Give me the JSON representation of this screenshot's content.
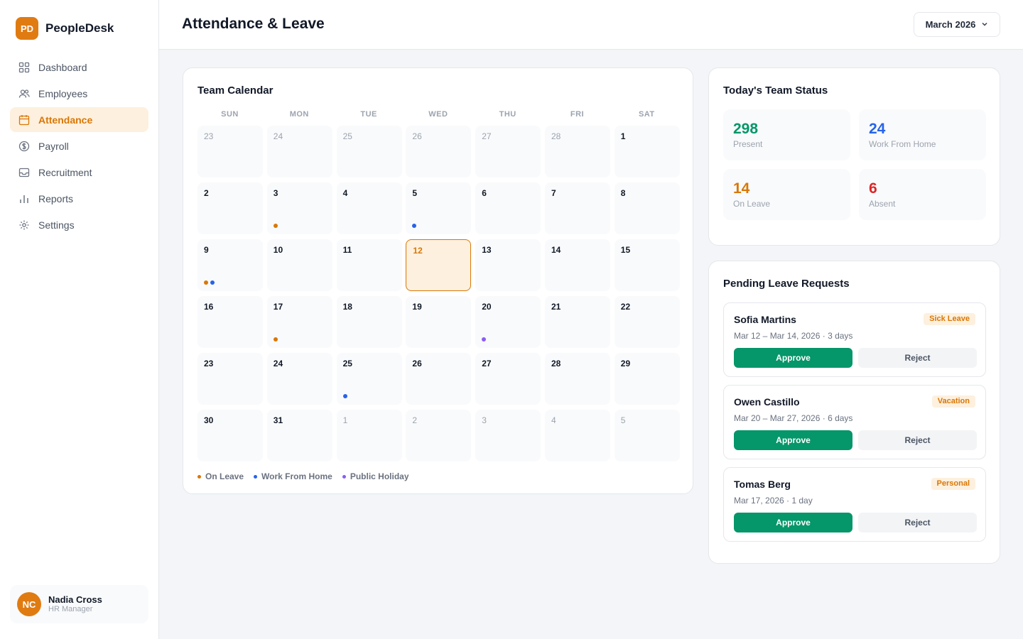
{
  "brand": {
    "logo": "PD",
    "name": "PeopleDesk"
  },
  "nav": [
    {
      "label": "Dashboard",
      "icon": "grid-icon",
      "active": false
    },
    {
      "label": "Employees",
      "icon": "users-icon",
      "active": false
    },
    {
      "label": "Attendance",
      "icon": "calendar-icon",
      "active": true
    },
    {
      "label": "Payroll",
      "icon": "dollar-icon",
      "active": false
    },
    {
      "label": "Recruitment",
      "icon": "inbox-icon",
      "active": false
    },
    {
      "label": "Reports",
      "icon": "bar-chart-icon",
      "active": false
    },
    {
      "label": "Settings",
      "icon": "gear-icon",
      "active": false
    }
  ],
  "user": {
    "initials": "NC",
    "name": "Nadia Cross",
    "role": "HR Manager"
  },
  "header": {
    "title": "Attendance & Leave",
    "month": "March 2026"
  },
  "calendar": {
    "title": "Team Calendar",
    "weekdays": [
      "SUN",
      "MON",
      "TUE",
      "WED",
      "THU",
      "FRI",
      "SAT"
    ],
    "days": [
      {
        "n": "23",
        "muted": true
      },
      {
        "n": "24",
        "muted": true
      },
      {
        "n": "25",
        "muted": true
      },
      {
        "n": "26",
        "muted": true
      },
      {
        "n": "27",
        "muted": true
      },
      {
        "n": "28",
        "muted": true
      },
      {
        "n": "1"
      },
      {
        "n": "2"
      },
      {
        "n": "3",
        "events": [
          "leave"
        ]
      },
      {
        "n": "4"
      },
      {
        "n": "5",
        "events": [
          "wfh"
        ]
      },
      {
        "n": "6"
      },
      {
        "n": "7"
      },
      {
        "n": "8"
      },
      {
        "n": "9",
        "events": [
          "leave",
          "wfh"
        ]
      },
      {
        "n": "10"
      },
      {
        "n": "11"
      },
      {
        "n": "12",
        "today": true
      },
      {
        "n": "13"
      },
      {
        "n": "14"
      },
      {
        "n": "15"
      },
      {
        "n": "16"
      },
      {
        "n": "17",
        "events": [
          "leave"
        ]
      },
      {
        "n": "18"
      },
      {
        "n": "19"
      },
      {
        "n": "20",
        "events": [
          "holiday"
        ]
      },
      {
        "n": "21"
      },
      {
        "n": "22"
      },
      {
        "n": "23"
      },
      {
        "n": "24"
      },
      {
        "n": "25",
        "events": [
          "wfh"
        ]
      },
      {
        "n": "26"
      },
      {
        "n": "27"
      },
      {
        "n": "28"
      },
      {
        "n": "29"
      },
      {
        "n": "30"
      },
      {
        "n": "31"
      },
      {
        "n": "1",
        "muted": true
      },
      {
        "n": "2",
        "muted": true
      },
      {
        "n": "3",
        "muted": true
      },
      {
        "n": "4",
        "muted": true
      },
      {
        "n": "5",
        "muted": true
      }
    ],
    "legend": [
      {
        "key": "leave",
        "label": "On Leave",
        "color": "#d97706"
      },
      {
        "key": "wfh",
        "label": "Work From Home",
        "color": "#2563eb"
      },
      {
        "key": "holiday",
        "label": "Public Holiday",
        "color": "#8b5cf6"
      }
    ]
  },
  "status": {
    "title": "Today's Team Status",
    "stats": [
      {
        "value": "298",
        "label": "Present",
        "color": "#059669"
      },
      {
        "value": "24",
        "label": "Work From Home",
        "color": "#2563eb"
      },
      {
        "value": "14",
        "label": "On Leave",
        "color": "#d97706"
      },
      {
        "value": "6",
        "label": "Absent",
        "color": "#dc2626"
      }
    ]
  },
  "leave_requests": {
    "title": "Pending Leave Requests",
    "approve_label": "Approve",
    "reject_label": "Reject",
    "items": [
      {
        "name": "Sofia Martins",
        "type": "Sick Leave",
        "dates": "Mar 12 – Mar 14, 2026 · 3 days"
      },
      {
        "name": "Owen Castillo",
        "type": "Vacation",
        "dates": "Mar 20 – Mar 27, 2026 · 6 days"
      },
      {
        "name": "Tomas Berg",
        "type": "Personal",
        "dates": "Mar 17, 2026 · 1 day"
      }
    ]
  }
}
